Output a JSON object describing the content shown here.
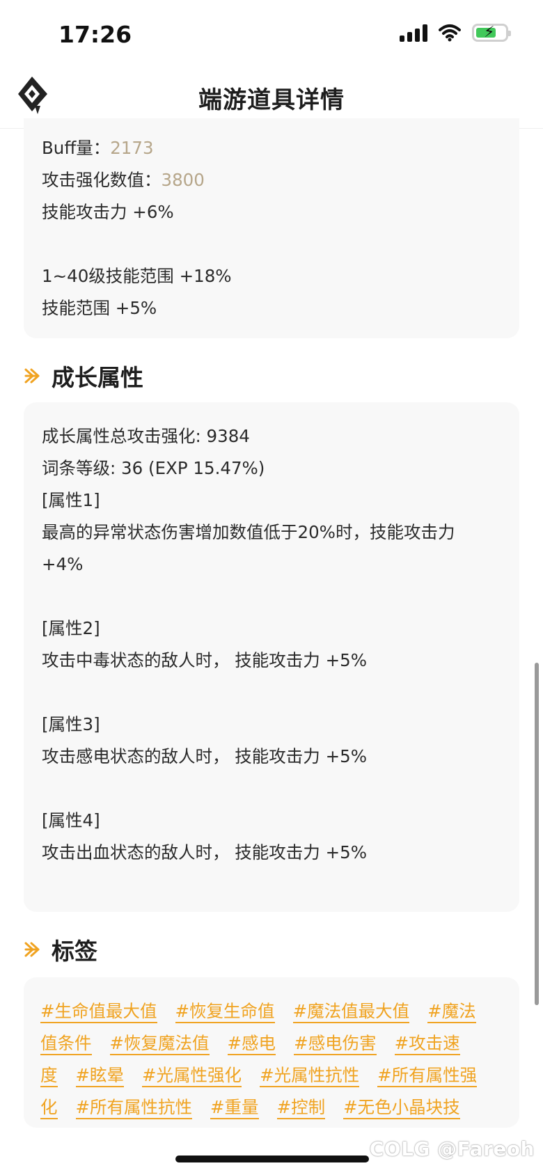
{
  "status_bar": {
    "time": "17:26"
  },
  "header": {
    "title": "端游道具详情"
  },
  "card1": {
    "buff_label": "Buff量：",
    "buff_value": "2173",
    "atk_label": "攻击强化数值：",
    "atk_value": "3800",
    "lines": [
      "技能攻击力 +6%",
      "",
      "1~40级技能范围 +18%",
      "技能范围 +5%"
    ]
  },
  "growth": {
    "title": "成长属性",
    "lines": [
      "成长属性总攻击强化: 9384",
      "词条等级: 36 (EXP 15.47%)",
      "[属性1]",
      "最高的异常状态伤害增加数值低于20%时，技能攻击力",
      "+4%",
      "",
      "[属性2]",
      "攻击中毒状态的敌人时， 技能攻击力 +5%",
      "",
      "[属性3]",
      "攻击感电状态的敌人时， 技能攻击力 +5%",
      "",
      "[属性4]",
      "攻击出血状态的敌人时， 技能攻击力 +5%"
    ]
  },
  "tags_section": {
    "title": "标签",
    "rows": [
      [
        "#生命值最大值",
        "#恢复生命值",
        "#魔法值最大值",
        "#魔法"
      ],
      [
        "值条件",
        "#恢复魔法值",
        "#感电",
        "#感电伤害",
        "#攻击速"
      ],
      [
        "度",
        "#眩晕",
        "#光属性强化",
        "#光属性抗性",
        "#所有属性强"
      ],
      [
        "化",
        "#所有属性抗性",
        "#重量",
        "#控制",
        "#无色小晶块技"
      ]
    ]
  },
  "watermark": "COLG @Fareoh",
  "colors": {
    "accent": "#f0a321",
    "value_muted": "#b6a68a",
    "card_bg": "#f8f8f8"
  }
}
